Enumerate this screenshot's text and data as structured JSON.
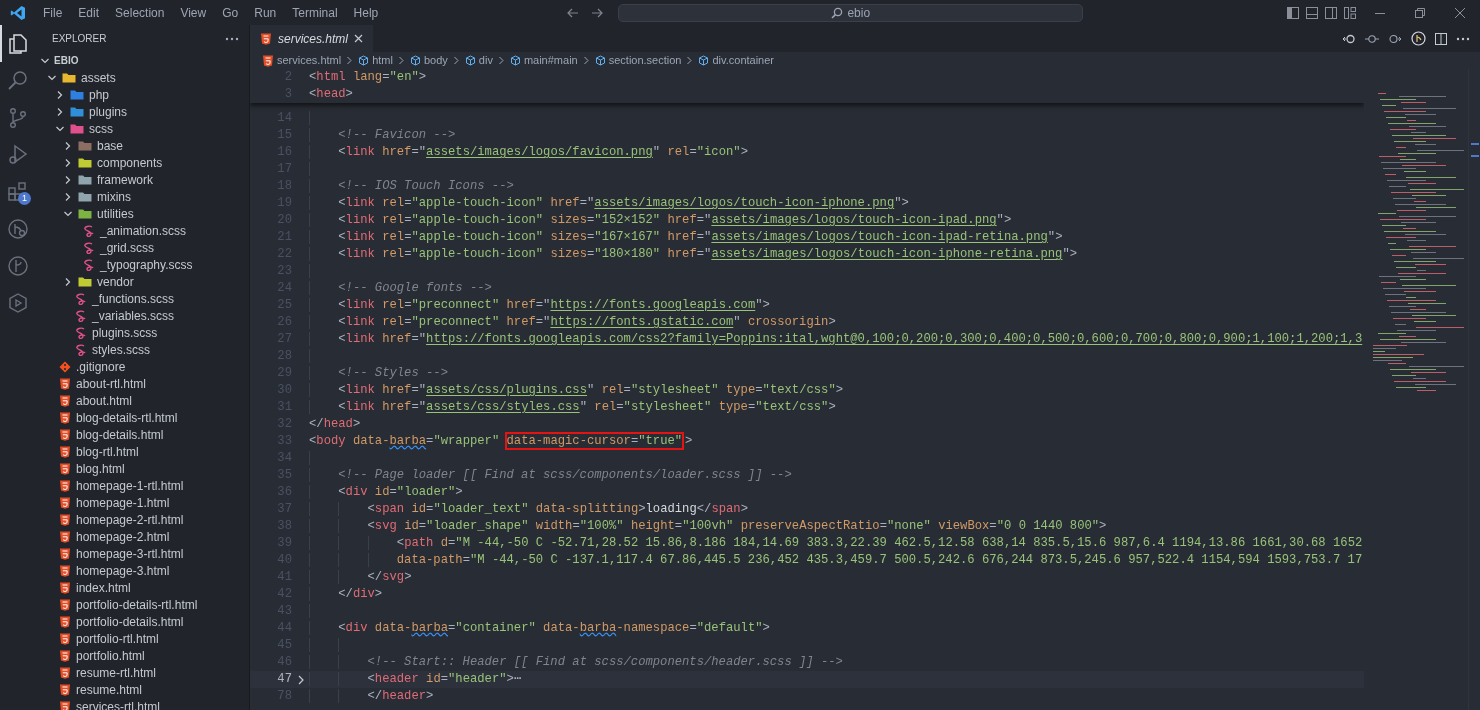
{
  "title_bar": {
    "menu": [
      "File",
      "Edit",
      "Selection",
      "View",
      "Go",
      "Run",
      "Terminal",
      "Help"
    ],
    "search": "ebio"
  },
  "activity_bar": [
    {
      "kind": "files",
      "selected": true
    },
    {
      "kind": "search",
      "selected": false
    },
    {
      "kind": "source-control",
      "selected": false
    },
    {
      "kind": "run",
      "selected": false
    },
    {
      "kind": "extensions",
      "selected": false,
      "badge": "1"
    },
    {
      "kind": "remote",
      "selected": false
    },
    {
      "kind": "branch",
      "selected": false
    },
    {
      "kind": "hexagon",
      "selected": false
    }
  ],
  "sidebar": {
    "title": "EXPLORER",
    "root": {
      "label": "EBIO",
      "expanded": true,
      "children": [
        {
          "kind": "folder",
          "label": "assets",
          "color": "#e8b730",
          "expanded": true,
          "children": [
            {
              "kind": "folder",
              "label": "php",
              "color": "#2f7fe0",
              "expanded": false
            },
            {
              "kind": "folder",
              "label": "plugins",
              "color": "#2f90d8",
              "expanded": false
            },
            {
              "kind": "folder",
              "label": "scss",
              "color": "#e0508c",
              "expanded": true,
              "children": [
                {
                  "kind": "folder",
                  "label": "base",
                  "color": "#8d6e63",
                  "expanded": false
                },
                {
                  "kind": "folder",
                  "label": "components",
                  "color": "#c0ca33",
                  "expanded": false
                },
                {
                  "kind": "folder",
                  "label": "framework",
                  "color": "#90a4ae",
                  "expanded": false
                },
                {
                  "kind": "folder",
                  "label": "mixins",
                  "color": "#90a4ae",
                  "expanded": false
                },
                {
                  "kind": "folder",
                  "label": "utilities",
                  "color": "#7cb342",
                  "expanded": true,
                  "children": [
                    {
                      "kind": "scss",
                      "label": "_animation.scss"
                    },
                    {
                      "kind": "scss",
                      "label": "_grid.scss"
                    },
                    {
                      "kind": "scss",
                      "label": "_typography.scss"
                    }
                  ]
                },
                {
                  "kind": "folder",
                  "label": "vendor",
                  "color": "#c0ca33",
                  "expanded": false
                },
                {
                  "kind": "scss",
                  "label": "_functions.scss"
                },
                {
                  "kind": "scss",
                  "label": "_variables.scss"
                },
                {
                  "kind": "scss",
                  "label": "plugins.scss"
                },
                {
                  "kind": "scss",
                  "label": "styles.scss"
                }
              ]
            }
          ]
        },
        {
          "kind": "git",
          "label": ".gitignore"
        },
        {
          "kind": "html",
          "label": "about-rtl.html"
        },
        {
          "kind": "html",
          "label": "about.html"
        },
        {
          "kind": "html",
          "label": "blog-details-rtl.html"
        },
        {
          "kind": "html",
          "label": "blog-details.html"
        },
        {
          "kind": "html",
          "label": "blog-rtl.html"
        },
        {
          "kind": "html",
          "label": "blog.html"
        },
        {
          "kind": "html",
          "label": "homepage-1-rtl.html"
        },
        {
          "kind": "html",
          "label": "homepage-1.html"
        },
        {
          "kind": "html",
          "label": "homepage-2-rtl.html"
        },
        {
          "kind": "html",
          "label": "homepage-2.html"
        },
        {
          "kind": "html",
          "label": "homepage-3-rtl.html"
        },
        {
          "kind": "html",
          "label": "homepage-3.html"
        },
        {
          "kind": "html",
          "label": "index.html"
        },
        {
          "kind": "html",
          "label": "portfolio-details-rtl.html"
        },
        {
          "kind": "html",
          "label": "portfolio-details.html"
        },
        {
          "kind": "html",
          "label": "portfolio-rtl.html"
        },
        {
          "kind": "html",
          "label": "portfolio.html"
        },
        {
          "kind": "html",
          "label": "resume-rtl.html"
        },
        {
          "kind": "html",
          "label": "resume.html"
        },
        {
          "kind": "html",
          "label": "services-rtl.html"
        }
      ]
    }
  },
  "tabs": [
    {
      "label": "services.html",
      "selected": true,
      "preview": true
    }
  ],
  "breadcrumbs": [
    {
      "kind": "html-file",
      "label": "services.html"
    },
    {
      "kind": "element",
      "label": "html"
    },
    {
      "kind": "element",
      "label": "body"
    },
    {
      "kind": "element",
      "label": "div"
    },
    {
      "kind": "element",
      "label": "main#main"
    },
    {
      "kind": "element",
      "label": "section.section"
    },
    {
      "kind": "element",
      "label": "div.container"
    }
  ],
  "editor": {
    "sticky_lines": [
      {
        "number": "2",
        "tokens": [
          {
            "kind": "p",
            "text": "<"
          },
          {
            "kind": "tag",
            "text": "html"
          },
          {
            "kind": "attr",
            "text": " lang"
          },
          {
            "kind": "p",
            "text": "="
          },
          {
            "kind": "str",
            "text": "\"en\""
          },
          {
            "kind": "p",
            "text": ">"
          }
        ]
      },
      {
        "number": "3",
        "tokens": [
          {
            "kind": "p",
            "text": "<"
          },
          {
            "kind": "tag",
            "text": "head"
          },
          {
            "kind": "p",
            "text": ">"
          }
        ]
      }
    ],
    "lines": [
      {
        "number": "14",
        "folded": false,
        "current": false
      },
      {
        "number": "15",
        "folded": false,
        "current": false,
        "tokens": [
          {
            "kind": "cmt",
            "text": "    <!-- Favicon -->"
          }
        ]
      },
      {
        "number": "16",
        "folded": false,
        "current": false,
        "tokens": [
          {
            "kind": "p",
            "text": "    <"
          },
          {
            "kind": "tag",
            "text": "link"
          },
          {
            "kind": "attr",
            "text": " href"
          },
          {
            "kind": "p",
            "text": "=\""
          },
          {
            "kind": "link",
            "text": "assets/images/logos/favicon.png"
          },
          {
            "kind": "p",
            "text": "\""
          },
          {
            "kind": "attr",
            "text": " rel"
          },
          {
            "kind": "p",
            "text": "="
          },
          {
            "kind": "str",
            "text": "\"icon\""
          },
          {
            "kind": "p",
            "text": ">"
          }
        ]
      },
      {
        "number": "17",
        "folded": false,
        "current": false
      },
      {
        "number": "18",
        "folded": false,
        "current": false,
        "tokens": [
          {
            "kind": "cmt",
            "text": "    <!-- IOS Touch Icons -->"
          }
        ]
      },
      {
        "number": "19",
        "folded": false,
        "current": false,
        "tokens": [
          {
            "kind": "p",
            "text": "    <"
          },
          {
            "kind": "tag",
            "text": "link"
          },
          {
            "kind": "attr",
            "text": " rel"
          },
          {
            "kind": "p",
            "text": "="
          },
          {
            "kind": "str",
            "text": "\"apple-touch-icon\""
          },
          {
            "kind": "attr",
            "text": " href"
          },
          {
            "kind": "p",
            "text": "=\""
          },
          {
            "kind": "link",
            "text": "assets/images/logos/touch-icon-iphone.png"
          },
          {
            "kind": "p",
            "text": "\">"
          }
        ]
      },
      {
        "number": "20",
        "folded": false,
        "current": false,
        "tokens": [
          {
            "kind": "p",
            "text": "    <"
          },
          {
            "kind": "tag",
            "text": "link"
          },
          {
            "kind": "attr",
            "text": " rel"
          },
          {
            "kind": "p",
            "text": "="
          },
          {
            "kind": "str",
            "text": "\"apple-touch-icon\""
          },
          {
            "kind": "attr",
            "text": " sizes"
          },
          {
            "kind": "p",
            "text": "="
          },
          {
            "kind": "str",
            "text": "\"152×152\""
          },
          {
            "kind": "attr",
            "text": " href"
          },
          {
            "kind": "p",
            "text": "=\""
          },
          {
            "kind": "link",
            "text": "assets/images/logos/touch-icon-ipad.png"
          },
          {
            "kind": "p",
            "text": "\">"
          }
        ]
      },
      {
        "number": "21",
        "folded": false,
        "current": false,
        "tokens": [
          {
            "kind": "p",
            "text": "    <"
          },
          {
            "kind": "tag",
            "text": "link"
          },
          {
            "kind": "attr",
            "text": " rel"
          },
          {
            "kind": "p",
            "text": "="
          },
          {
            "kind": "str",
            "text": "\"apple-touch-icon\""
          },
          {
            "kind": "attr",
            "text": " sizes"
          },
          {
            "kind": "p",
            "text": "="
          },
          {
            "kind": "str",
            "text": "\"167×167\""
          },
          {
            "kind": "attr",
            "text": " href"
          },
          {
            "kind": "p",
            "text": "=\""
          },
          {
            "kind": "link",
            "text": "assets/images/logos/touch-icon-ipad-retina.png"
          },
          {
            "kind": "p",
            "text": "\">"
          }
        ]
      },
      {
        "number": "22",
        "folded": false,
        "current": false,
        "tokens": [
          {
            "kind": "p",
            "text": "    <"
          },
          {
            "kind": "tag",
            "text": "link"
          },
          {
            "kind": "attr",
            "text": " rel"
          },
          {
            "kind": "p",
            "text": "="
          },
          {
            "kind": "str",
            "text": "\"apple-touch-icon\""
          },
          {
            "kind": "attr",
            "text": " sizes"
          },
          {
            "kind": "p",
            "text": "="
          },
          {
            "kind": "str",
            "text": "\"180×180\""
          },
          {
            "kind": "attr",
            "text": " href"
          },
          {
            "kind": "p",
            "text": "=\""
          },
          {
            "kind": "link",
            "text": "assets/images/logos/touch-icon-iphone-retina.png"
          },
          {
            "kind": "p",
            "text": "\">"
          }
        ]
      },
      {
        "number": "23",
        "folded": false,
        "current": false
      },
      {
        "number": "24",
        "folded": false,
        "current": false,
        "tokens": [
          {
            "kind": "cmt",
            "text": "    <!-- Google fonts -->"
          }
        ]
      },
      {
        "number": "25",
        "folded": false,
        "current": false,
        "tokens": [
          {
            "kind": "p",
            "text": "    <"
          },
          {
            "kind": "tag",
            "text": "link"
          },
          {
            "kind": "attr",
            "text": " rel"
          },
          {
            "kind": "p",
            "text": "="
          },
          {
            "kind": "str",
            "text": "\"preconnect\""
          },
          {
            "kind": "attr",
            "text": " href"
          },
          {
            "kind": "p",
            "text": "=\""
          },
          {
            "kind": "link",
            "text": "https://fonts.googleapis.com"
          },
          {
            "kind": "p",
            "text": "\">"
          }
        ]
      },
      {
        "number": "26",
        "folded": false,
        "current": false,
        "tokens": [
          {
            "kind": "p",
            "text": "    <"
          },
          {
            "kind": "tag",
            "text": "link"
          },
          {
            "kind": "attr",
            "text": " rel"
          },
          {
            "kind": "p",
            "text": "="
          },
          {
            "kind": "str",
            "text": "\"preconnect\""
          },
          {
            "kind": "attr",
            "text": " href"
          },
          {
            "kind": "p",
            "text": "=\""
          },
          {
            "kind": "link",
            "text": "https://fonts.gstatic.com"
          },
          {
            "kind": "p",
            "text": "\""
          },
          {
            "kind": "attr",
            "text": " crossorigin"
          },
          {
            "kind": "p",
            "text": ">"
          }
        ]
      },
      {
        "number": "27",
        "folded": false,
        "current": false,
        "tokens": [
          {
            "kind": "p",
            "text": "    <"
          },
          {
            "kind": "tag",
            "text": "link"
          },
          {
            "kind": "attr",
            "text": " href"
          },
          {
            "kind": "p",
            "text": "=\""
          },
          {
            "kind": "link",
            "text": "https://fonts.googleapis.com/css2?family=Poppins:ital,wght@0,100;0,200;0,300;0,400;0,500;0,600;0,700;0,800;0,900;1,100;1,200;1,3"
          }
        ]
      },
      {
        "number": "28",
        "folded": false,
        "current": false
      },
      {
        "number": "29",
        "folded": false,
        "current": false,
        "tokens": [
          {
            "kind": "cmt",
            "text": "    <!-- Styles -->"
          }
        ]
      },
      {
        "number": "30",
        "folded": false,
        "current": false,
        "tokens": [
          {
            "kind": "p",
            "text": "    <"
          },
          {
            "kind": "tag",
            "text": "link"
          },
          {
            "kind": "attr",
            "text": " href"
          },
          {
            "kind": "p",
            "text": "=\""
          },
          {
            "kind": "link",
            "text": "assets/css/plugins.css"
          },
          {
            "kind": "p",
            "text": "\""
          },
          {
            "kind": "attr",
            "text": " rel"
          },
          {
            "kind": "p",
            "text": "="
          },
          {
            "kind": "str",
            "text": "\"stylesheet\""
          },
          {
            "kind": "attr",
            "text": " type"
          },
          {
            "kind": "p",
            "text": "="
          },
          {
            "kind": "str",
            "text": "\"text/css\""
          },
          {
            "kind": "p",
            "text": ">"
          }
        ]
      },
      {
        "number": "31",
        "folded": false,
        "current": false,
        "tokens": [
          {
            "kind": "p",
            "text": "    <"
          },
          {
            "kind": "tag",
            "text": "link"
          },
          {
            "kind": "attr",
            "text": " href"
          },
          {
            "kind": "p",
            "text": "=\""
          },
          {
            "kind": "link",
            "text": "assets/css/styles.css"
          },
          {
            "kind": "p",
            "text": "\""
          },
          {
            "kind": "attr",
            "text": " rel"
          },
          {
            "kind": "p",
            "text": "="
          },
          {
            "kind": "str",
            "text": "\"stylesheet\""
          },
          {
            "kind": "attr",
            "text": " type"
          },
          {
            "kind": "p",
            "text": "="
          },
          {
            "kind": "str",
            "text": "\"text/css\""
          },
          {
            "kind": "p",
            "text": ">"
          }
        ]
      },
      {
        "number": "32",
        "folded": false,
        "current": false,
        "tokens": [
          {
            "kind": "p",
            "text": "</"
          },
          {
            "kind": "tag",
            "text": "head"
          },
          {
            "kind": "p",
            "text": ">"
          }
        ]
      },
      {
        "number": "33",
        "folded": false,
        "current": false,
        "tokens": [
          {
            "kind": "p",
            "text": "<"
          },
          {
            "kind": "tag",
            "text": "body"
          },
          {
            "kind": "attr",
            "text": " data-"
          },
          {
            "kind": "attr",
            "text": "barba",
            "squiggle": true
          },
          {
            "kind": "p",
            "text": "="
          },
          {
            "kind": "str",
            "text": "\"wrapper\" "
          },
          {
            "kind": "boxed",
            "tokens": [
              {
                "kind": "attr",
                "text": "data-magic-cursor"
              },
              {
                "kind": "p",
                "text": "="
              },
              {
                "kind": "str",
                "text": "\"true\""
              }
            ]
          },
          {
            "kind": "p",
            "text": ">"
          }
        ]
      },
      {
        "number": "34",
        "folded": false,
        "current": false
      },
      {
        "number": "35",
        "folded": false,
        "current": false,
        "tokens": [
          {
            "kind": "cmt",
            "text": "    <!-- Page loader [[ Find at scss/components/loader.scss ]] -->"
          }
        ]
      },
      {
        "number": "36",
        "folded": false,
        "current": false,
        "tokens": [
          {
            "kind": "p",
            "text": "    <"
          },
          {
            "kind": "tag",
            "text": "div"
          },
          {
            "kind": "attr",
            "text": " id"
          },
          {
            "kind": "p",
            "text": "="
          },
          {
            "kind": "str",
            "text": "\"loader\""
          },
          {
            "kind": "p",
            "text": ">"
          }
        ]
      },
      {
        "number": "37",
        "folded": false,
        "current": false,
        "tokens": [
          {
            "kind": "p",
            "text": "        <"
          },
          {
            "kind": "tag",
            "text": "span"
          },
          {
            "kind": "attr",
            "text": " id"
          },
          {
            "kind": "p",
            "text": "="
          },
          {
            "kind": "str",
            "text": "\"loader_text\""
          },
          {
            "kind": "attr",
            "text": " data-splitting"
          },
          {
            "kind": "p",
            "text": ">"
          },
          {
            "kind": "text",
            "text": "loading"
          },
          {
            "kind": "p",
            "text": "</"
          },
          {
            "kind": "tag",
            "text": "span"
          },
          {
            "kind": "p",
            "text": ">"
          }
        ]
      },
      {
        "number": "38",
        "folded": false,
        "current": false,
        "tokens": [
          {
            "kind": "p",
            "text": "        <"
          },
          {
            "kind": "tag",
            "text": "svg"
          },
          {
            "kind": "attr",
            "text": " id"
          },
          {
            "kind": "p",
            "text": "="
          },
          {
            "kind": "str",
            "text": "\"loader_shape\""
          },
          {
            "kind": "attr",
            "text": " width"
          },
          {
            "kind": "p",
            "text": "="
          },
          {
            "kind": "str",
            "text": "\"100%\""
          },
          {
            "kind": "attr",
            "text": " height"
          },
          {
            "kind": "p",
            "text": "="
          },
          {
            "kind": "str",
            "text": "\"100vh\""
          },
          {
            "kind": "attr",
            "text": " preserveAspectRatio"
          },
          {
            "kind": "p",
            "text": "="
          },
          {
            "kind": "str",
            "text": "\"none\""
          },
          {
            "kind": "attr",
            "text": " viewBox"
          },
          {
            "kind": "p",
            "text": "="
          },
          {
            "kind": "str",
            "text": "\"0 0 1440 800\""
          },
          {
            "kind": "p",
            "text": ">"
          }
        ]
      },
      {
        "number": "39",
        "folded": false,
        "current": false,
        "tokens": [
          {
            "kind": "p",
            "text": "            <"
          },
          {
            "kind": "tag",
            "text": "path"
          },
          {
            "kind": "attr",
            "text": " d"
          },
          {
            "kind": "p",
            "text": "="
          },
          {
            "kind": "str",
            "text": "\"M -44,-50 C -52.71,28.52 15.86,8.186 184,14.69 383.3,22.39 462.5,12.58 638,14 835.5,15.6 987,6.4 1194,13.86 1661,30.68 1652"
          }
        ]
      },
      {
        "number": "40",
        "folded": false,
        "current": false,
        "tokens": [
          {
            "kind": "attr",
            "text": "            data-path"
          },
          {
            "kind": "p",
            "text": "="
          },
          {
            "kind": "str",
            "text": "\"M -44,-50 C -137.1,117.4 67.86,445.5 236,452 435.3,459.7 500.5,242.6 676,244 873.5,245.6 957,522.4 1154,594 1593,753.7 17"
          }
        ]
      },
      {
        "number": "41",
        "folded": false,
        "current": false,
        "tokens": [
          {
            "kind": "p",
            "text": "        </"
          },
          {
            "kind": "tag",
            "text": "svg"
          },
          {
            "kind": "p",
            "text": ">"
          }
        ]
      },
      {
        "number": "42",
        "folded": false,
        "current": false,
        "tokens": [
          {
            "kind": "p",
            "text": "    </"
          },
          {
            "kind": "tag",
            "text": "div"
          },
          {
            "kind": "p",
            "text": ">"
          }
        ]
      },
      {
        "number": "43",
        "folded": false,
        "current": false
      },
      {
        "number": "44",
        "folded": false,
        "current": false,
        "tokens": [
          {
            "kind": "p",
            "text": "    <"
          },
          {
            "kind": "tag",
            "text": "div"
          },
          {
            "kind": "attr",
            "text": " data-"
          },
          {
            "kind": "attr",
            "text": "barba",
            "squiggle": true
          },
          {
            "kind": "p",
            "text": "="
          },
          {
            "kind": "str",
            "text": "\"container\""
          },
          {
            "kind": "attr",
            "text": " data-"
          },
          {
            "kind": "attr",
            "text": "barba",
            "squiggle": true
          },
          {
            "kind": "attr",
            "text": "-namespace"
          },
          {
            "kind": "p",
            "text": "="
          },
          {
            "kind": "str",
            "text": "\"default\""
          },
          {
            "kind": "p",
            "text": ">"
          }
        ]
      },
      {
        "number": "45",
        "folded": false,
        "current": false
      },
      {
        "number": "46",
        "folded": false,
        "current": false,
        "tokens": [
          {
            "kind": "cmt",
            "text": "        <!-- Start:: Header [[ Find at scss/components/header.scss ]] -->"
          }
        ]
      },
      {
        "number": "47",
        "folded": true,
        "current": true,
        "tokens": [
          {
            "kind": "p",
            "text": "        <"
          },
          {
            "kind": "tag",
            "text": "header"
          },
          {
            "kind": "attr",
            "text": " id"
          },
          {
            "kind": "p",
            "text": "="
          },
          {
            "kind": "str",
            "text": "\"header\""
          },
          {
            "kind": "p",
            "text": ">"
          },
          {
            "kind": "fold",
            "text": "⋯"
          }
        ]
      },
      {
        "number": "78",
        "folded": false,
        "current": false,
        "tokens": [
          {
            "kind": "p",
            "text": "        </"
          },
          {
            "kind": "tag",
            "text": "header"
          },
          {
            "kind": "p",
            "text": ">"
          }
        ]
      }
    ]
  }
}
